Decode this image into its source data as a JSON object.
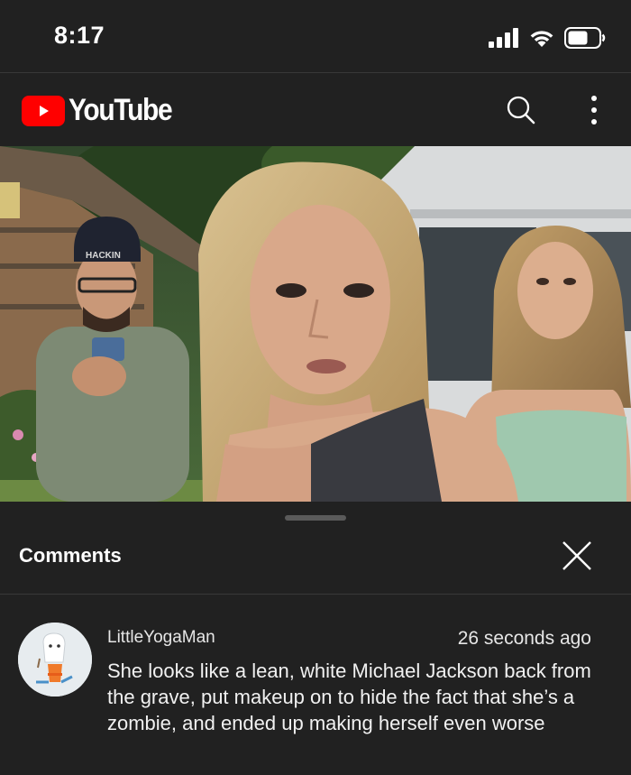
{
  "status_bar": {
    "time": "8:17",
    "icons": [
      "signal-icon",
      "wifi-icon",
      "battery-icon"
    ]
  },
  "app_bar": {
    "logo_text": "YouTube",
    "brand_color": "#ff0000",
    "actions": [
      "search-icon",
      "more-vert-icon"
    ]
  },
  "video": {
    "hat_text": "HACKIN"
  },
  "comments_panel": {
    "title": "Comments",
    "close_icon": "close-icon",
    "comments": [
      {
        "author": "LittleYogaMan",
        "time": "26 seconds ago",
        "text": "She looks like a lean, white Michael Jackson back from the grave, put makeup on to hide the fact that she’s a zombie, and ended up making herself even worse"
      }
    ]
  }
}
